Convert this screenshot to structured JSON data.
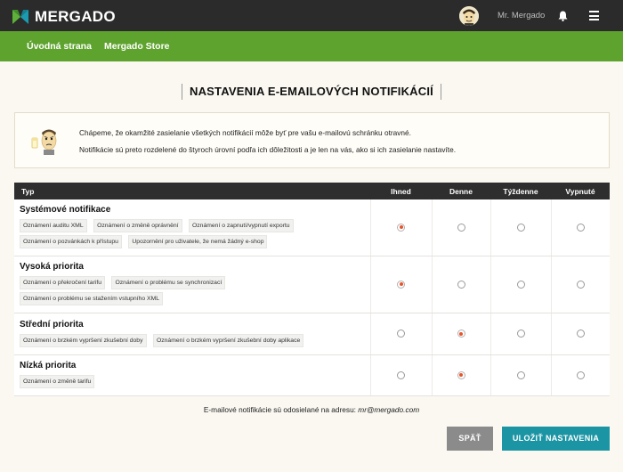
{
  "topbar": {
    "logo_text": "MERGADO",
    "username": "Mr. Mergado",
    "icons": [
      "mergado-logo-icon",
      "avatar",
      "bell-icon",
      "hamburger-menu-icon"
    ]
  },
  "nav": {
    "items": [
      {
        "label": "Úvodná strana"
      },
      {
        "label": "Mergado Store"
      }
    ]
  },
  "page": {
    "title": "NASTAVENIA E-EMAILOVÝCH NOTIFIKÁCIÍ"
  },
  "info": {
    "line1": "Chápeme, že okamžité zasielanie všetkých notifikácií môže byť pre vašu e-mailovú schránku otravné.",
    "line2": "Notifikácie sú preto rozdelené do štyroch úrovní podľa ich dôležitosti a je len na vás, ako si ich zasielanie nastavíte."
  },
  "table": {
    "headers": {
      "type": "Typ",
      "immediate": "Ihned",
      "daily": "Denne",
      "weekly": "Týždenne",
      "off": "Vypnuté"
    },
    "rows": [
      {
        "name": "Systémové notifikace",
        "tags": [
          "Oznámení auditu XML",
          "Oznámení o změně oprávnění",
          "Oznámení o zapnutí/vypnutí exportu",
          "Oznámení o pozvánkách k přístupu",
          "Upozornění pro uživatele, že nemá žádný e-shop"
        ],
        "selected": "immediate"
      },
      {
        "name": "Vysoká priorita",
        "tags": [
          "Oznámení o překročení tarifu",
          "Oznámení o problému se synchronizací",
          "Oznámení o problému se stažením vstupního XML"
        ],
        "selected": "immediate"
      },
      {
        "name": "Střední priorita",
        "tags": [
          "Oznámení o brzkém vypršení zkušební doby",
          "Oznámení o brzkém vypršení zkušební doby aplikace"
        ],
        "selected": "daily"
      },
      {
        "name": "Nízká priorita",
        "tags": [
          "Oznámení o změně tarifu"
        ],
        "selected": "daily"
      }
    ]
  },
  "footer": {
    "note_prefix": "E-mailové notifikácie sú odosielané na adresu:",
    "email": "mr@mergado.com"
  },
  "buttons": {
    "back": "SPÄŤ",
    "save": "ULOŽIŤ NASTAVENIA"
  },
  "colors": {
    "topbar": "#2b2b2b",
    "navbar": "#5fa32f",
    "radio_selected": "#e8542b",
    "save_button": "#1b94a3",
    "back_button": "#8b8b8b"
  }
}
